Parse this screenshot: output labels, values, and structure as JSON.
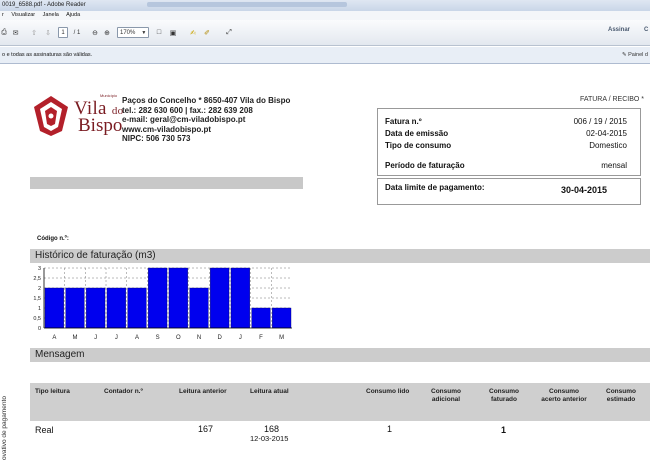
{
  "window": {
    "title": "0019_6588.pdf - Adobe Reader"
  },
  "menu": {
    "items": [
      "r",
      "Visualizar",
      "Janela",
      "Ajuda"
    ]
  },
  "toolbar": {
    "page_current": "1",
    "page_total": "/ 1",
    "zoom": "170%",
    "sign_label": "Assinar",
    "comment_label": "C"
  },
  "signature_bar": {
    "message": "o e todas as assinaturas são válidas.",
    "panel_label": "Painel d"
  },
  "issuer": {
    "logo_small": "Município",
    "logo_line1": "Vila",
    "logo_do": "do",
    "logo_line2": "Bispo",
    "address": "Paços do Concelho * 8650-407 Vila do Bispo",
    "phone": "tel.: 282 630 600 | fax.: 282 639 208",
    "email": "e-mail: geral@cm-viladobispo.pt",
    "web": "www.cm-viladobispo.pt",
    "nipc": "NIPC: 506 730 573"
  },
  "document_type": "FATURA / RECIBO *",
  "invoice": {
    "fatura_label": "Fatura n.º",
    "fatura_value": "006 / 19 / 2015",
    "emissao_label": "Data de emissão",
    "emissao_value": "02-04-2015",
    "consumo_label": "Tipo de consumo",
    "consumo_value": "Domestico",
    "periodo_label": "Período de faturação",
    "periodo_value": "mensal",
    "limite_label": "Data limite de pagamento:",
    "limite_value": "30-04-2015"
  },
  "codigo_label": "Código n.º:",
  "historico_title": "Histórico de faturação (m3)",
  "mensagem_title": "Mensagem",
  "chart_data": {
    "type": "bar",
    "categories": [
      "A",
      "M",
      "J",
      "J",
      "A",
      "S",
      "O",
      "N",
      "D",
      "J",
      "F",
      "M"
    ],
    "values": [
      2,
      2,
      2,
      2,
      2,
      3,
      3,
      2,
      3,
      3,
      1,
      1
    ],
    "ylim": [
      0,
      3
    ],
    "yticks": [
      "0",
      "0,5",
      "1",
      "1,5",
      "2",
      "2,5",
      "3"
    ],
    "grid": true,
    "bar_color": "#0000ee"
  },
  "table": {
    "headers": {
      "tipo": "Tipo leitura",
      "contador": "Contador n.º",
      "anterior": "Leitura anterior",
      "atual": "Leitura atual",
      "lido": "Consumo lido",
      "adicional_1": "Consumo",
      "adicional_2": "adicional",
      "faturado_1": "Consumo",
      "faturado_2": "faturado",
      "acerto_1": "Consumo",
      "acerto_2": "acerto anterior",
      "estimado_1": "Consumo",
      "estimado_2": "estimado"
    },
    "row": {
      "tipo": "Real",
      "anterior": "167",
      "atual": "168",
      "atual_date": "12-03-2015",
      "lido": "1",
      "faturado": "1"
    }
  },
  "side_text": "ovativo de pagamento"
}
